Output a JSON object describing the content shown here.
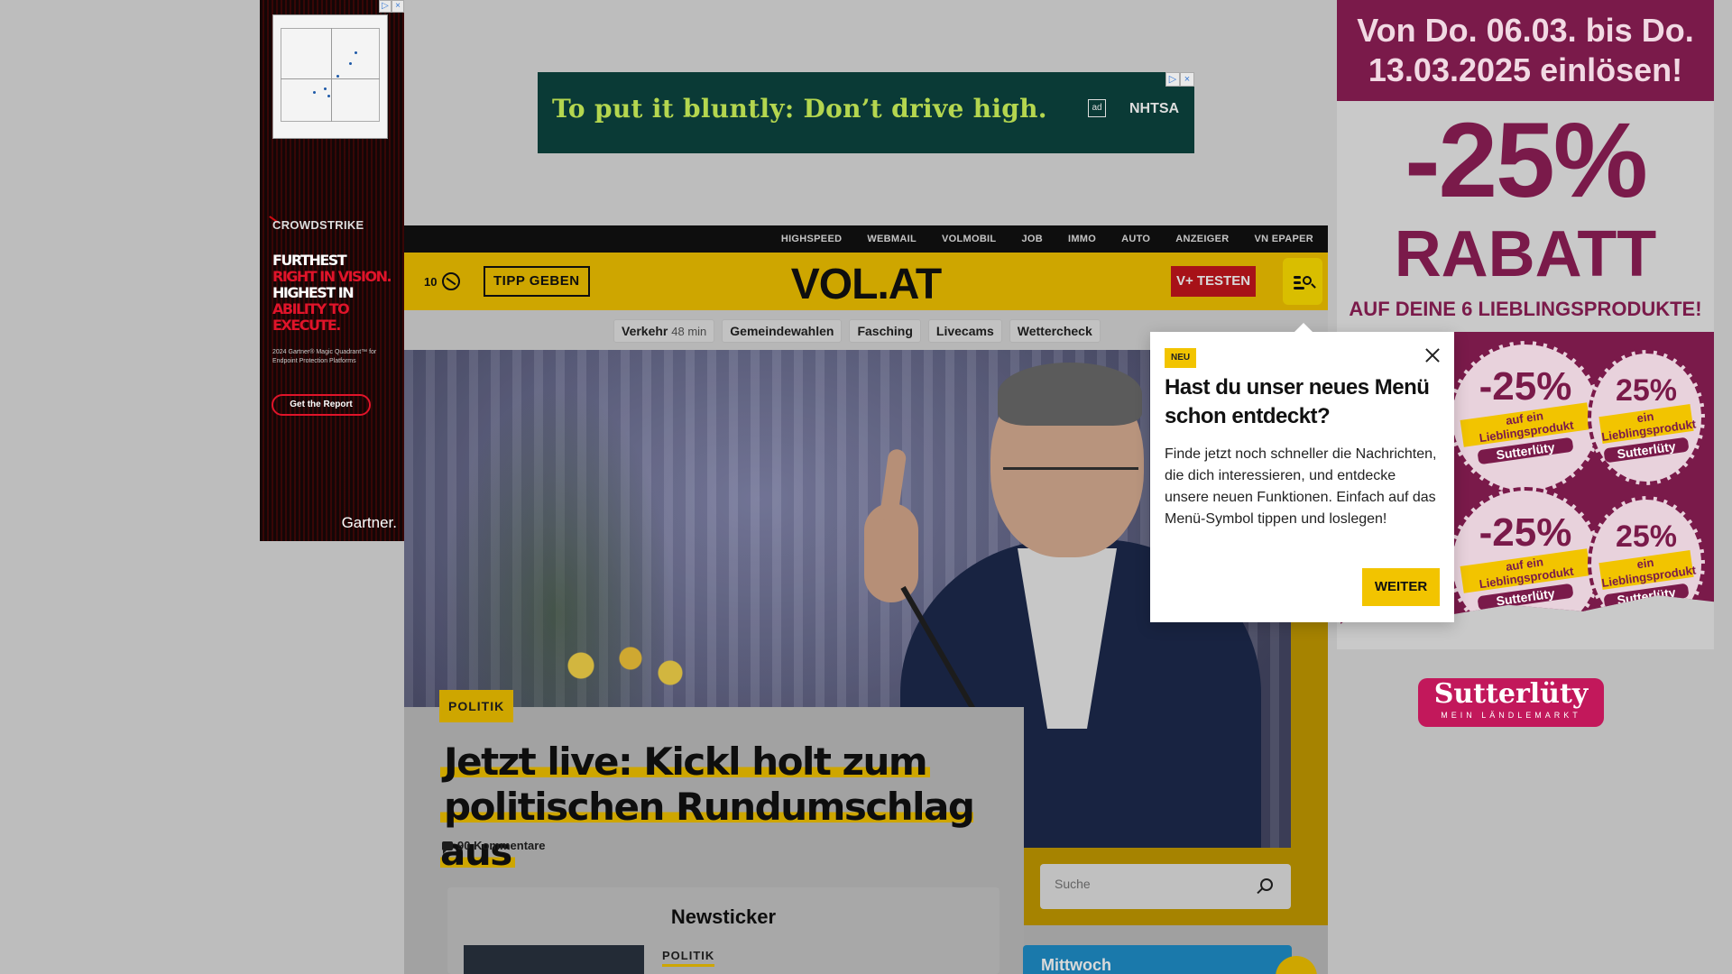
{
  "ads": {
    "left": {
      "brand": "CROWDSTRIKE",
      "headline_white1": "FURTHEST",
      "headline_red1": "RIGHT IN VISION.",
      "headline_white2": "HIGHEST IN",
      "headline_red2": "ABILITY TO EXECUTE.",
      "sub": "2024 Gartner® Magic Quadrant™ for Endpoint Protection Platforms",
      "cta": "Get the Report",
      "footer": "Gartner.",
      "colors": {
        "accent": "#e0142a",
        "bg": "#0d0d0d"
      }
    },
    "top": {
      "message": "To put it bluntly: Don’t drive high.",
      "ad_mark": "ad",
      "sponsor": "NHTSA",
      "colors": {
        "bg": "#0a3a36",
        "text": "#b4d64f"
      }
    },
    "right": {
      "dates": "Von Do. 06.03. bis Do. 13.03.2025 einlösen!",
      "percent": "-25%",
      "rabatt": "RABATT",
      "tagline": "AUF DEINE 6 LIEBLINGSPRODUKTE!",
      "stamp_pct_big": "-25%",
      "stamp_pct_small": "25%",
      "stamp_band": "auf ein Lieblingsprodukt",
      "stamp_band_small": "ein Lieblingsprodukt",
      "stamp_brand": "Sutterlüty",
      "logo": "Sutterlüty",
      "logo_tag": "MEIN LÄNDLEMARKT",
      "colors": {
        "primary": "#7a1a4a",
        "logo": "#c2185b"
      }
    }
  },
  "topnav": [
    "HIGHSPEED",
    "WEBMAIL",
    "VOLMOBIL",
    "JOB",
    "IMMO",
    "AUTO",
    "ANZEIGER",
    "VN EPAPER"
  ],
  "header": {
    "temperature": "10",
    "weather_icon": "weather-icon",
    "tipp_label": "TIPP GEBEN",
    "logo": "VOL.AT",
    "vplus_label": "V+ TESTEN",
    "menu_icon": "menu-search-icon",
    "colors": {
      "header_bg": "#f2c400",
      "vplus": "#c5161d"
    }
  },
  "chips": [
    {
      "label": "Verkehr",
      "extra": "48 min"
    },
    {
      "label": "Gemeindewahlen",
      "extra": ""
    },
    {
      "label": "Fasching",
      "extra": ""
    },
    {
      "label": "Livecams",
      "extra": ""
    },
    {
      "label": "Wettercheck",
      "extra": ""
    }
  ],
  "article": {
    "category": "POLITIK",
    "headline_line1": "Jetzt live: Kickl holt zum",
    "headline_line2": "politischen Rundumschlag aus",
    "comments": "90 Kommentare"
  },
  "newsticker": {
    "title": "Newsticker",
    "category": "POLITIK"
  },
  "search": {
    "placeholder": "Suche"
  },
  "weather_card": {
    "day": "Mittwoch"
  },
  "popup": {
    "badge": "NEU",
    "title": "Hast du unser neues Menü schon entdeckt?",
    "body": "Finde jetzt noch schneller die Nachrichten, die dich interessieren, und entdecke unsere neuen Funktionen. Einfach auf das Menü-Symbol tippen und loslegen!",
    "button": "WEITER"
  }
}
